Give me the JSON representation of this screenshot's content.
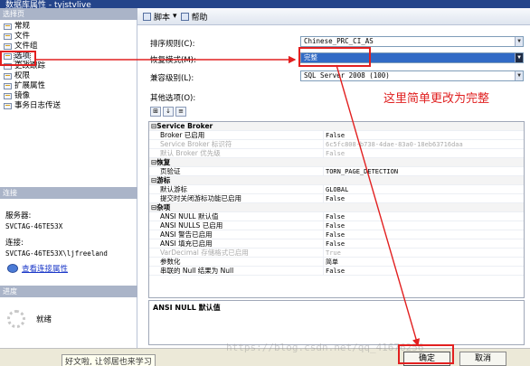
{
  "window": {
    "title": "数据库属性 - tyjstvlive"
  },
  "left_pane": {
    "header_pages": "选择页",
    "pages": [
      {
        "label": "常规"
      },
      {
        "label": "文件"
      },
      {
        "label": "文件组"
      },
      {
        "label": "选项"
      },
      {
        "label": "更改跟踪"
      },
      {
        "label": "权限"
      },
      {
        "label": "扩展属性"
      },
      {
        "label": "镜像"
      },
      {
        "label": "事务日志传送"
      }
    ],
    "header_connection": "连接",
    "server_label": "服务器:",
    "server_value": "SVCTAG-46TE53X",
    "connection_label": "连接:",
    "connection_value": "SVCTAG-46TE53X\\ljfreeland",
    "view_link": "查看连接属性",
    "header_progress": "进度",
    "progress_status": "就绪"
  },
  "toolbar": {
    "script_label": "脚本",
    "help_label": "帮助"
  },
  "form": {
    "collation_label": "排序规则(C):",
    "collation_value": "Chinese_PRC_CI_AS",
    "recovery_label": "恢复模式(M):",
    "recovery_value": "完整",
    "compat_label": "兼容级别(L):",
    "compat_value": "SQL Server 2008 (100)",
    "other_label": "其他选项(O):"
  },
  "annotation": {
    "text": "这里简单更改为完整",
    "color": "#e02020"
  },
  "grid": {
    "rows": [
      {
        "type": "cat",
        "name": "Service Broker",
        "value": ""
      },
      {
        "type": "prop",
        "name": "Broker 已启用",
        "value": "False"
      },
      {
        "type": "ro",
        "name": "Service Broker 标识符",
        "value": "6c5fc808-b738-4dae-83a0-18eb63716daa"
      },
      {
        "type": "ro",
        "name": "默认 Broker 优先级",
        "value": "False"
      },
      {
        "type": "cat",
        "name": "恢复",
        "value": ""
      },
      {
        "type": "prop",
        "name": "页验证",
        "value": "TORN_PAGE_DETECTION"
      },
      {
        "type": "cat",
        "name": "游标",
        "value": ""
      },
      {
        "type": "prop",
        "name": "默认游标",
        "value": "GLOBAL"
      },
      {
        "type": "prop",
        "name": "提交时关闭游标功能已启用",
        "value": "False"
      },
      {
        "type": "cat",
        "name": "杂项",
        "value": ""
      },
      {
        "type": "prop",
        "name": "ANSI NULL 默认值",
        "value": "False"
      },
      {
        "type": "prop",
        "name": "ANSI NULLS 已启用",
        "value": "False"
      },
      {
        "type": "prop",
        "name": "ANSI 警告已启用",
        "value": "False"
      },
      {
        "type": "prop",
        "name": "ANSI 填充已启用",
        "value": "False"
      },
      {
        "type": "ro",
        "name": "VarDecimal 存储格式已启用",
        "value": "True"
      },
      {
        "type": "prop",
        "name": "参数化",
        "value": "简单"
      },
      {
        "type": "prop",
        "name": "串联的 Null 结果为 Null",
        "value": "False"
      }
    ]
  },
  "description": {
    "title": "ANSI NULL 默认值"
  },
  "footer": {
    "tooltip_text": "好文啦, 让邻居也来学习",
    "ok_label": "确定",
    "cancel_label": "取消",
    "watermark": "https://blog.csdn.net/qq_41676256"
  },
  "colors": {
    "selection": "#316ac5",
    "titlebar": "#24448a",
    "highlight_box": "#e22020"
  }
}
